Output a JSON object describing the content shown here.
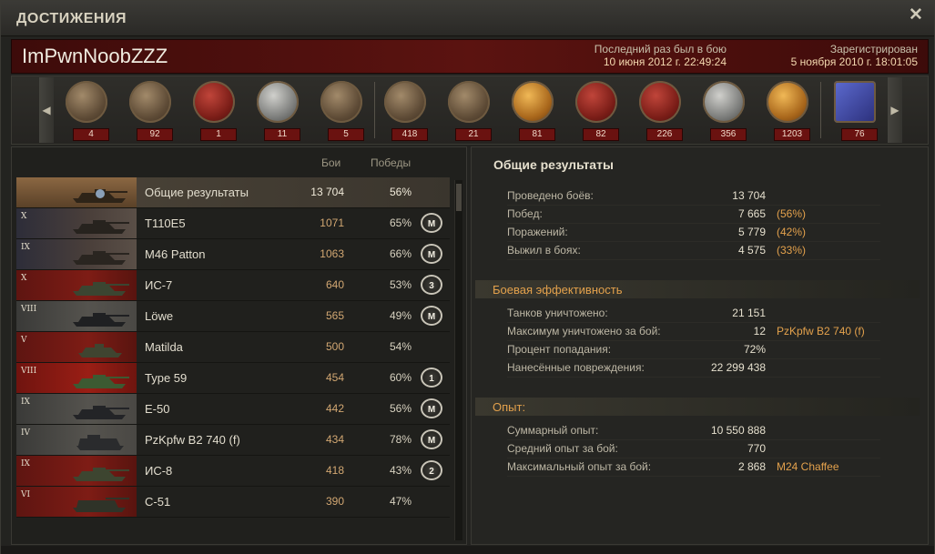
{
  "window": {
    "title": "ДОСТИЖЕНИЯ",
    "close": "✕"
  },
  "header": {
    "player_name": "ImPwnNoobZZZ",
    "last_battle_label": "Последний раз был в бою",
    "last_battle_value": "10 июня 2012 г. 22:49:24",
    "registered_label": "Зарегистрирован",
    "registered_value": "5 ноября 2010 г. 18:01:05"
  },
  "medals": [
    {
      "icon": "tank-medal-icon",
      "count": "4"
    },
    {
      "icon": "tank-medal-icon",
      "count": "92"
    },
    {
      "icon": "tank-medal-icon",
      "count": "1"
    },
    {
      "icon": "tank-medal-icon",
      "count": "11"
    },
    {
      "icon": "tank-medal-icon",
      "count": "5"
    },
    {
      "icon": "wot-emblem-medal-icon",
      "count": "418"
    },
    {
      "icon": "tank-medal-icon",
      "count": "21"
    },
    {
      "icon": "star-medal-icon",
      "count": "81"
    },
    {
      "icon": "red-shield-medal-icon",
      "count": "82"
    },
    {
      "icon": "tank-medal-icon",
      "count": "226"
    },
    {
      "icon": "silver-shield-medal-icon",
      "count": "356"
    },
    {
      "icon": "target-medal-icon",
      "count": "1203"
    },
    {
      "icon": "purple-badge-medal-icon",
      "count": "76"
    }
  ],
  "vehicles": {
    "col_battles": "Бои",
    "col_wins": "Победы",
    "summary": {
      "name": "Общие результаты",
      "battles": "13 704",
      "wins": "56%"
    },
    "rows": [
      {
        "tier": "X",
        "nation": "us",
        "name": "T110E5",
        "battles": "1071",
        "wins": "65%",
        "mastery": "M"
      },
      {
        "tier": "IX",
        "nation": "us",
        "name": "M46 Patton",
        "battles": "1063",
        "wins": "66%",
        "mastery": "M"
      },
      {
        "tier": "X",
        "nation": "su",
        "name": "ИС-7",
        "battles": "640",
        "wins": "53%",
        "mastery": "3"
      },
      {
        "tier": "VIII",
        "nation": "de",
        "name": "Löwe",
        "battles": "565",
        "wins": "49%",
        "mastery": "M"
      },
      {
        "tier": "V",
        "nation": "su",
        "name": "Matilda",
        "battles": "500",
        "wins": "54%",
        "mastery": ""
      },
      {
        "tier": "VIII",
        "nation": "cn",
        "name": "Type 59",
        "battles": "454",
        "wins": "60%",
        "mastery": "1"
      },
      {
        "tier": "IX",
        "nation": "de",
        "name": "E-50",
        "battles": "442",
        "wins": "56%",
        "mastery": "M"
      },
      {
        "tier": "IV",
        "nation": "de",
        "name": "PzKpfw B2 740 (f)",
        "battles": "434",
        "wins": "78%",
        "mastery": "M"
      },
      {
        "tier": "IX",
        "nation": "su",
        "name": "ИС-8",
        "battles": "418",
        "wins": "43%",
        "mastery": "2"
      },
      {
        "tier": "VI",
        "nation": "su",
        "name": "С-51",
        "battles": "390",
        "wins": "47%",
        "mastery": ""
      }
    ]
  },
  "results": {
    "title": "Общие результаты",
    "general": [
      {
        "label": "Проведено боёв:",
        "value": "13 704",
        "extra": ""
      },
      {
        "label": "Побед:",
        "value": "7 665",
        "extra": "(56%)"
      },
      {
        "label": "Поражений:",
        "value": "5 779",
        "extra": "(42%)"
      },
      {
        "label": "Выжил в боях:",
        "value": "4 575",
        "extra": "(33%)"
      }
    ],
    "efficiency_title": "Боевая эффективность",
    "efficiency": [
      {
        "label": "Танков уничтожено:",
        "value": "21 151",
        "extra": ""
      },
      {
        "label": "Максимум уничтожено за бой:",
        "value": "12",
        "extra": "PzKpfw B2 740 (f)"
      },
      {
        "label": "Процент попадания:",
        "value": "72%",
        "extra": ""
      },
      {
        "label": "Нанесённые повреждения:",
        "value": "22 299 438",
        "extra": ""
      }
    ],
    "experience_title": "Опыт:",
    "experience": [
      {
        "label": "Суммарный опыт:",
        "value": "10 550 888",
        "extra": ""
      },
      {
        "label": "Средний опыт за бой:",
        "value": "770",
        "extra": ""
      },
      {
        "label": "Максимальный опыт за бой:",
        "value": "2 868",
        "extra": "M24 Chaffee"
      }
    ]
  }
}
